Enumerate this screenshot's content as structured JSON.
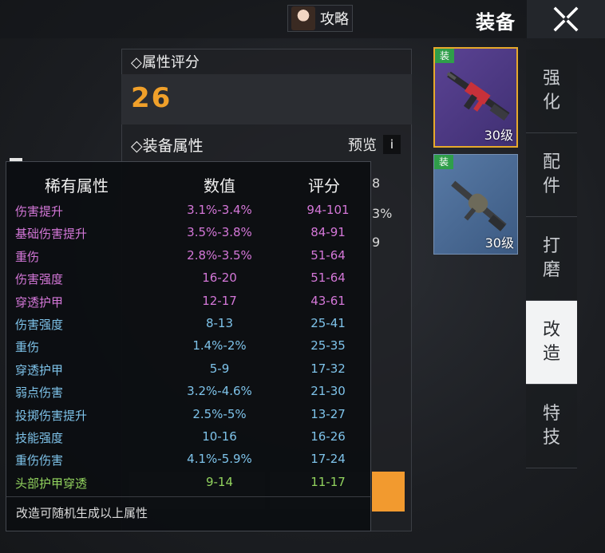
{
  "header": {
    "guide_label": "攻略",
    "title": "装备"
  },
  "tabs": [
    {
      "label": "强化",
      "active": false
    },
    {
      "label": "配件",
      "active": false
    },
    {
      "label": "打磨",
      "active": false
    },
    {
      "label": "改造",
      "active": true
    },
    {
      "label": "特技",
      "active": false
    }
  ],
  "slots": [
    {
      "tag": "装",
      "level": "30级",
      "selected": true
    },
    {
      "tag": "装",
      "level": "30级",
      "selected": false
    }
  ],
  "panel": {
    "score_title": "◇属性评分",
    "score": "26",
    "equip_title": "◇装备属性",
    "preview_label": "预览",
    "info_icon": "i",
    "partial_values": [
      "8",
      "3%",
      "9"
    ]
  },
  "popup": {
    "headers": [
      "稀有属性",
      "数值",
      "评分"
    ],
    "rows": [
      {
        "name": "伤害提升",
        "value": "3.1%-3.4%",
        "score": "94-101",
        "tier": "purple"
      },
      {
        "name": "基础伤害提升",
        "value": "3.5%-3.8%",
        "score": "84-91",
        "tier": "purple"
      },
      {
        "name": "重伤",
        "value": "2.8%-3.5%",
        "score": "51-64",
        "tier": "purple"
      },
      {
        "name": "伤害强度",
        "value": "16-20",
        "score": "51-64",
        "tier": "purple"
      },
      {
        "name": "穿透护甲",
        "value": "12-17",
        "score": "43-61",
        "tier": "purple"
      },
      {
        "name": "伤害强度",
        "value": "8-13",
        "score": "25-41",
        "tier": "blue"
      },
      {
        "name": "重伤",
        "value": "1.4%-2%",
        "score": "25-35",
        "tier": "blue"
      },
      {
        "name": "穿透护甲",
        "value": "5-9",
        "score": "17-32",
        "tier": "blue"
      },
      {
        "name": "弱点伤害",
        "value": "3.2%-4.6%",
        "score": "21-30",
        "tier": "blue"
      },
      {
        "name": "投掷伤害提升",
        "value": "2.5%-5%",
        "score": "13-27",
        "tier": "blue"
      },
      {
        "name": "技能强度",
        "value": "10-16",
        "score": "16-26",
        "tier": "blue"
      },
      {
        "name": "重伤伤害",
        "value": "4.1%-5.9%",
        "score": "17-24",
        "tier": "blue"
      },
      {
        "name": "头部护甲穿透",
        "value": "9-14",
        "score": "11-17",
        "tier": "green"
      }
    ],
    "footer": "改造可随机生成以上属性"
  },
  "colors": {
    "purple": "#d477d8",
    "blue": "#7ec3ea",
    "green": "#92d35e",
    "score": "#f0a02a",
    "accent": "#f29a2f"
  }
}
